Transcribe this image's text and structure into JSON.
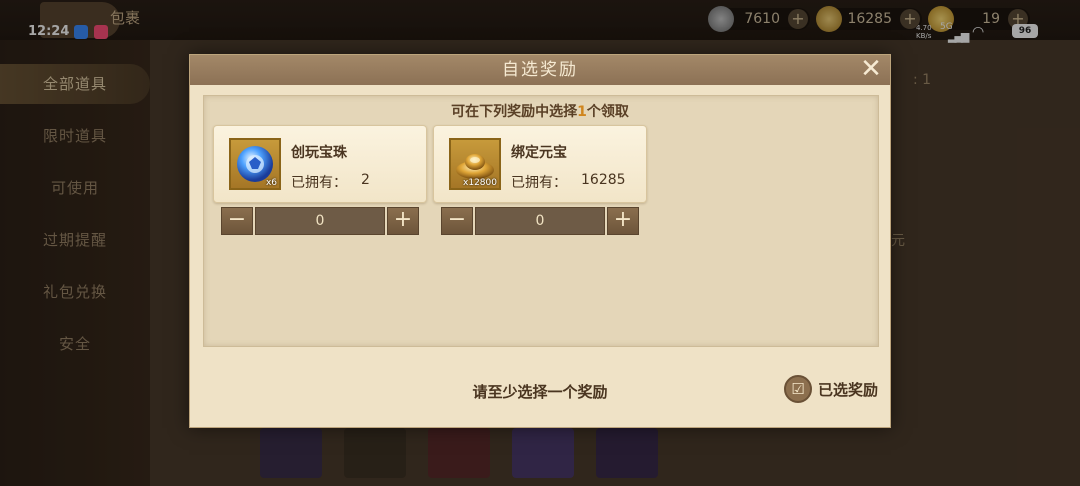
{
  "status_bar": {
    "time": "12:24",
    "net_speed": "4.70\nKB/s",
    "network": "5G",
    "battery": "96"
  },
  "header": {
    "title": "包裹"
  },
  "resources": [
    {
      "icon": "silver-ingot-icon",
      "value": "7610"
    },
    {
      "icon": "gold-ingot-icon",
      "value": "16285"
    },
    {
      "icon": "gold-coin-icon",
      "value": "19"
    }
  ],
  "sidebar": {
    "items": [
      {
        "label": "全部道具",
        "active": true
      },
      {
        "label": "限时道具",
        "active": false
      },
      {
        "label": "可使用",
        "active": false
      },
      {
        "label": "过期提醒",
        "active": false
      },
      {
        "label": "礼包兑换",
        "active": false
      },
      {
        "label": "安全",
        "active": false
      }
    ]
  },
  "background_fragments": {
    "right_top": ": 1",
    "right_mid": "元"
  },
  "modal": {
    "title": "自选奖励",
    "close_symbol": "✕",
    "instruction_prefix": "可在下列奖励中选择",
    "instruction_count": "1",
    "instruction_suffix": "个领取",
    "rewards": [
      {
        "name": "创玩宝珠",
        "icon": "blue-orb-icon",
        "qty_badge": "x6",
        "owned_label": "已拥有：",
        "owned_value": "2",
        "selected_count": "0"
      },
      {
        "name": "绑定元宝",
        "icon": "gold-ingot-icon",
        "qty_badge": "x12800",
        "owned_label": "已拥有：",
        "owned_value": "16285",
        "selected_count": "0"
      }
    ],
    "stepper_minus": "−",
    "stepper_plus": "+",
    "hint": "请至少选择一个奖励",
    "selected_button_label": "已选奖励"
  },
  "colors": {
    "accent": "#d0861f",
    "modal_bg": "#efe2c6",
    "header_bg": "#8c7155"
  }
}
